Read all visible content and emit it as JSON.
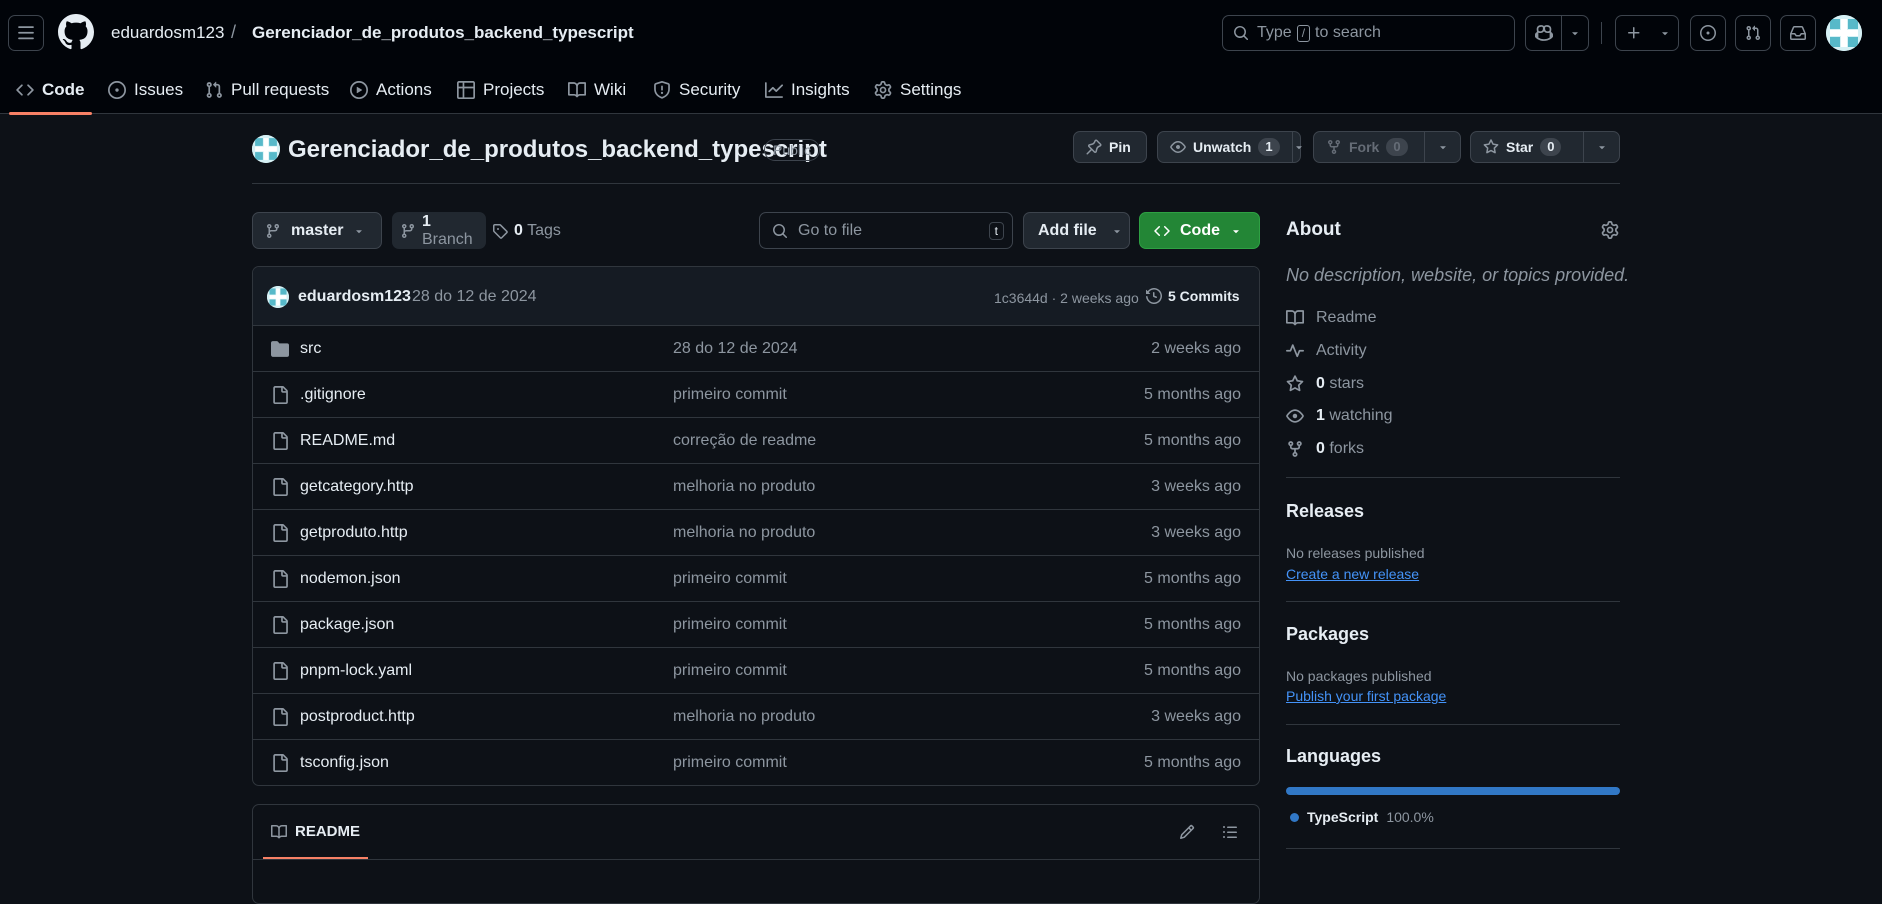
{
  "header": {
    "owner": "eduardosm123",
    "separator": "/",
    "repo": "Gerenciador_de_produtos_backend_typescript",
    "search_prefix": "Type",
    "search_key": "/",
    "search_suffix": "to search"
  },
  "tabs": [
    {
      "label": "Code",
      "icon": "code-icon"
    },
    {
      "label": "Issues",
      "icon": "issue-icon"
    },
    {
      "label": "Pull requests",
      "icon": "pull-request-icon"
    },
    {
      "label": "Actions",
      "icon": "play-icon"
    },
    {
      "label": "Projects",
      "icon": "table-icon"
    },
    {
      "label": "Wiki",
      "icon": "book-icon"
    },
    {
      "label": "Security",
      "icon": "shield-icon"
    },
    {
      "label": "Insights",
      "icon": "graph-icon"
    },
    {
      "label": "Settings",
      "icon": "gear-icon"
    }
  ],
  "repo_head": {
    "title": "Gerenciador_de_produtos_backend_typescript",
    "visibility": "Public",
    "pin": "Pin",
    "unwatch": "Unwatch",
    "watch_count": "1",
    "fork": "Fork",
    "fork_count": "0",
    "star": "Star",
    "star_count": "0"
  },
  "toolbar": {
    "branch": "master",
    "branch_count": "1",
    "branch_label": "Branch",
    "tag_count": "0",
    "tag_label": "Tags",
    "goto_placeholder": "Go to file",
    "goto_key": "t",
    "add_file": "Add file",
    "code": "Code"
  },
  "commit": {
    "author": "eduardosm123",
    "message": "28 do 12 de 2024",
    "sha_time": "1c3644d · 2 weeks ago",
    "count": "5 Commits"
  },
  "files": [
    {
      "name": "src",
      "type": "folder",
      "message": "28 do 12 de 2024",
      "age": "2 weeks ago"
    },
    {
      "name": ".gitignore",
      "type": "file",
      "message": "primeiro commit",
      "age": "5 months ago"
    },
    {
      "name": "README.md",
      "type": "file",
      "message": "correção de readme",
      "age": "5 months ago"
    },
    {
      "name": "getcategory.http",
      "type": "file",
      "message": "melhoria no produto",
      "age": "3 weeks ago"
    },
    {
      "name": "getproduto.http",
      "type": "file",
      "message": "melhoria no produto",
      "age": "3 weeks ago"
    },
    {
      "name": "nodemon.json",
      "type": "file",
      "message": "primeiro commit",
      "age": "5 months ago"
    },
    {
      "name": "package.json",
      "type": "file",
      "message": "primeiro commit",
      "age": "5 months ago"
    },
    {
      "name": "pnpm-lock.yaml",
      "type": "file",
      "message": "primeiro commit",
      "age": "5 months ago"
    },
    {
      "name": "postproduct.http",
      "type": "file",
      "message": "melhoria no produto",
      "age": "3 weeks ago"
    },
    {
      "name": "tsconfig.json",
      "type": "file",
      "message": "primeiro commit",
      "age": "5 months ago"
    }
  ],
  "readme": {
    "tab": "README"
  },
  "about": {
    "title": "About",
    "description": "No description, website, or topics provided.",
    "readme": "Readme",
    "activity": "Activity",
    "stars_count": "0",
    "stars_label": "stars",
    "watching_count": "1",
    "watching_label": "watching",
    "forks_count": "0",
    "forks_label": "forks"
  },
  "releases": {
    "title": "Releases",
    "text": "No releases published",
    "link": "Create a new release"
  },
  "packages": {
    "title": "Packages",
    "text": "No packages published",
    "link": "Publish your first package"
  },
  "languages": {
    "title": "Languages",
    "items": [
      {
        "name": "TypeScript",
        "percent": "100.0%",
        "color": "#3178c6"
      }
    ]
  },
  "colors": {
    "accent_green": "#238636",
    "tab_underline": "#f78166",
    "link": "#4493f8"
  }
}
